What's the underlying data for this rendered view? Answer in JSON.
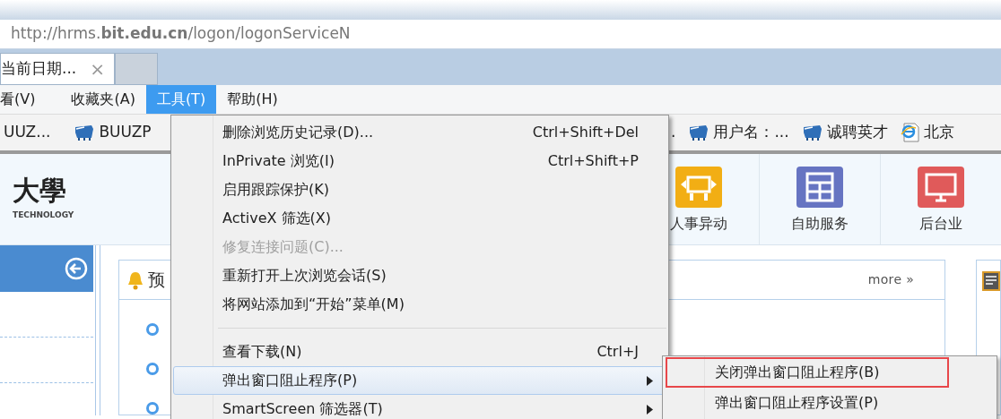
{
  "address_bar": {
    "url": "http://hrms.**bit.edu.cn**/logon/logonServiceN"
  },
  "tabs": [
    {
      "label": "当前日期...",
      "close": "×",
      "selected": true
    }
  ],
  "menu_bar": [
    {
      "label": "看(V)",
      "selected": false
    },
    {
      "label": "收藏夹(A)",
      "selected": false
    },
    {
      "label": "工具(T)",
      "selected": true
    },
    {
      "label": "帮助(H)",
      "selected": false
    }
  ],
  "favorites_left": [
    {
      "label": "UUZ...",
      "kind": "plain"
    },
    {
      "label": "BUUZP",
      "kind": "site"
    }
  ],
  "favorites_right": [
    {
      "label": ".",
      "kind": "plain"
    },
    {
      "label": "用户名：...",
      "kind": "site"
    },
    {
      "label": "诚聘英才",
      "kind": "site"
    },
    {
      "label": "北京",
      "kind": "ie"
    }
  ],
  "header": {
    "logo_title": "大學",
    "logo_subtitle": "TECHNOLOGY",
    "nav": [
      {
        "label": "人事异动",
        "color": "#f2ae14",
        "kind": "transfer"
      },
      {
        "label": "自助服务",
        "color": "#6674c2",
        "kind": "grid"
      },
      {
        "label": "后台业",
        "color": "#e05a5a",
        "kind": "monitor"
      }
    ]
  },
  "notice_panel": {
    "title": "预",
    "more": "more »"
  },
  "tools_menu": {
    "items": [
      {
        "kind": "item",
        "label": "删除浏览历史记录(D)...",
        "shortcut": "Ctrl+Shift+Del",
        "disabled": false,
        "selected": false
      },
      {
        "kind": "item",
        "label": "InPrivate 浏览(I)",
        "shortcut": "Ctrl+Shift+P",
        "disabled": false,
        "selected": false
      },
      {
        "kind": "item",
        "label": "启用跟踪保护(K)",
        "disabled": false,
        "selected": false
      },
      {
        "kind": "item",
        "label": "ActiveX 筛选(X)",
        "disabled": false,
        "selected": false
      },
      {
        "kind": "item",
        "label": "修复连接问题(C)...",
        "disabled": true,
        "selected": false
      },
      {
        "kind": "item",
        "label": "重新打开上次浏览会话(S)",
        "disabled": false,
        "selected": false
      },
      {
        "kind": "item",
        "label": "将网站添加到“开始”菜单(M)",
        "disabled": false,
        "selected": false
      },
      {
        "kind": "separator"
      },
      {
        "kind": "item",
        "label": "查看下载(N)",
        "shortcut": "Ctrl+J",
        "disabled": false,
        "selected": false
      },
      {
        "kind": "submenu",
        "label": "弹出窗口阻止程序(P)",
        "disabled": false,
        "selected": true
      },
      {
        "kind": "submenu",
        "label": "SmartScreen 筛选器(T)",
        "disabled": false,
        "selected": false
      }
    ]
  },
  "submenu": {
    "items": [
      {
        "label": "关闭弹出窗口阻止程序(B)",
        "outlined": true
      },
      {
        "label": "弹出窗口阻止程序设置(P)",
        "outlined": false
      }
    ]
  }
}
